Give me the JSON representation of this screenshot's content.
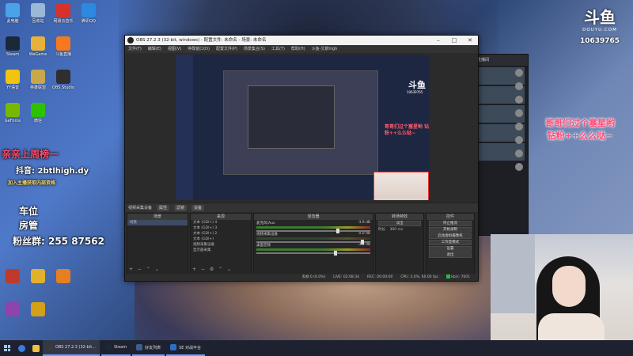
{
  "desktop": {
    "icons": [
      {
        "label": "此电脑",
        "color": "#4aa3e8"
      },
      {
        "label": "回收站",
        "color": "#9bb8d6"
      },
      {
        "label": "网易云音乐",
        "color": "#d7312b"
      },
      {
        "label": "腾讯QQ",
        "color": "#2b8ae0"
      },
      {
        "label": "Steam",
        "color": "#1b2838"
      },
      {
        "label": "WeGame",
        "color": "#e6b23a"
      },
      {
        "label": "斗鱼直播",
        "color": "#f7781e"
      },
      {
        "label": "YY语音",
        "color": "#f1c40f"
      },
      {
        "label": "英雄联盟",
        "color": "#c8a84b"
      },
      {
        "label": "OBS Studio",
        "color": "#302e31"
      },
      {
        "label": "GeForce",
        "color": "#76b900"
      },
      {
        "label": "微信",
        "color": "#2dc100"
      }
    ]
  },
  "overlay": {
    "line1": "亲亲上周榜一",
    "line2": "抖音: 2btlhigh.dy",
    "line3": "车位",
    "line4": "房管",
    "line5": "粉丝群: 25‌5 87562",
    "line2b": "加入主播获取内部资格"
  },
  "obs": {
    "title": "OBS 27.2.3 (32-bit, windows) - 配置文件: 未命名 - 场景: 未命名",
    "menu": [
      "文件(F)",
      "编辑(E)",
      "视图(V)",
      "停靠窗口(D)",
      "配置文件(P)",
      "场景集合(S)",
      "工具(T)",
      "帮助(H)",
      "斗鱼-艾斯high"
    ],
    "source_bar": {
      "name": "视频采集设备",
      "props": "属性",
      "filters": "滤镜",
      "device": "设备"
    },
    "docks": {
      "scenes": {
        "title": "场景",
        "items": [
          "场景"
        ]
      },
      "sources": {
        "title": "来源",
        "items": [
          "文本 (GDI+) 4",
          "文本 (GDI+) 3",
          "文本 (GDI+) 2",
          "文本 (GDI+)",
          "视频采集设备",
          "显示器采集"
        ]
      },
      "mixer": {
        "title": "混音器",
        "channels": [
          {
            "name": "麦克风/Aux",
            "db": "-3.9 dB"
          },
          {
            "name": "视频采集设备",
            "db": "0.0 dB"
          },
          {
            "name": "桌面音频",
            "db": "-3.8 dB"
          }
        ]
      },
      "transitions": {
        "title": "转场特效",
        "type": "淡出",
        "duration_label": "时长",
        "duration": "300 ms"
      },
      "controls": {
        "title": "控件",
        "buttons": [
          "停止推流",
          "开始录制",
          "启动虚拟摄像机",
          "工作室模式",
          "设置",
          "退出"
        ]
      }
    },
    "status": {
      "dropped": "丢帧 0 (0.0%)",
      "live": "LIVE: 02:08:34",
      "rec": "REC: 00:00:00",
      "cpu": "CPU: 3.0%, 60.00 fps",
      "kbps": "kb/s: 7601"
    }
  },
  "preview": {
    "red_text": "哥哥们过个塞星哟 钻粉++么么哒~",
    "logo": "斗鱼",
    "number": "10639765"
  },
  "right_panel": {
    "title": "直播间",
    "sub": "直播间"
  },
  "douyu": {
    "mark": "斗鱼",
    "site": "DOUYU.COM",
    "room": "10639765"
  },
  "side_message": {
    "line1": "哥哥们过个塞星哟",
    "line2": "钻粉++么么哒~"
  },
  "taskbar": {
    "apps": [
      {
        "label": "OBS 27.2.3 (32-bit...",
        "color": "#3a3a3a"
      },
      {
        "label": "Steam",
        "color": "#1b2838"
      },
      {
        "label": "好友列表",
        "color": "#3d5f8f"
      },
      {
        "label": "SE 对战平台",
        "color": "#2a6fc9"
      }
    ]
  }
}
